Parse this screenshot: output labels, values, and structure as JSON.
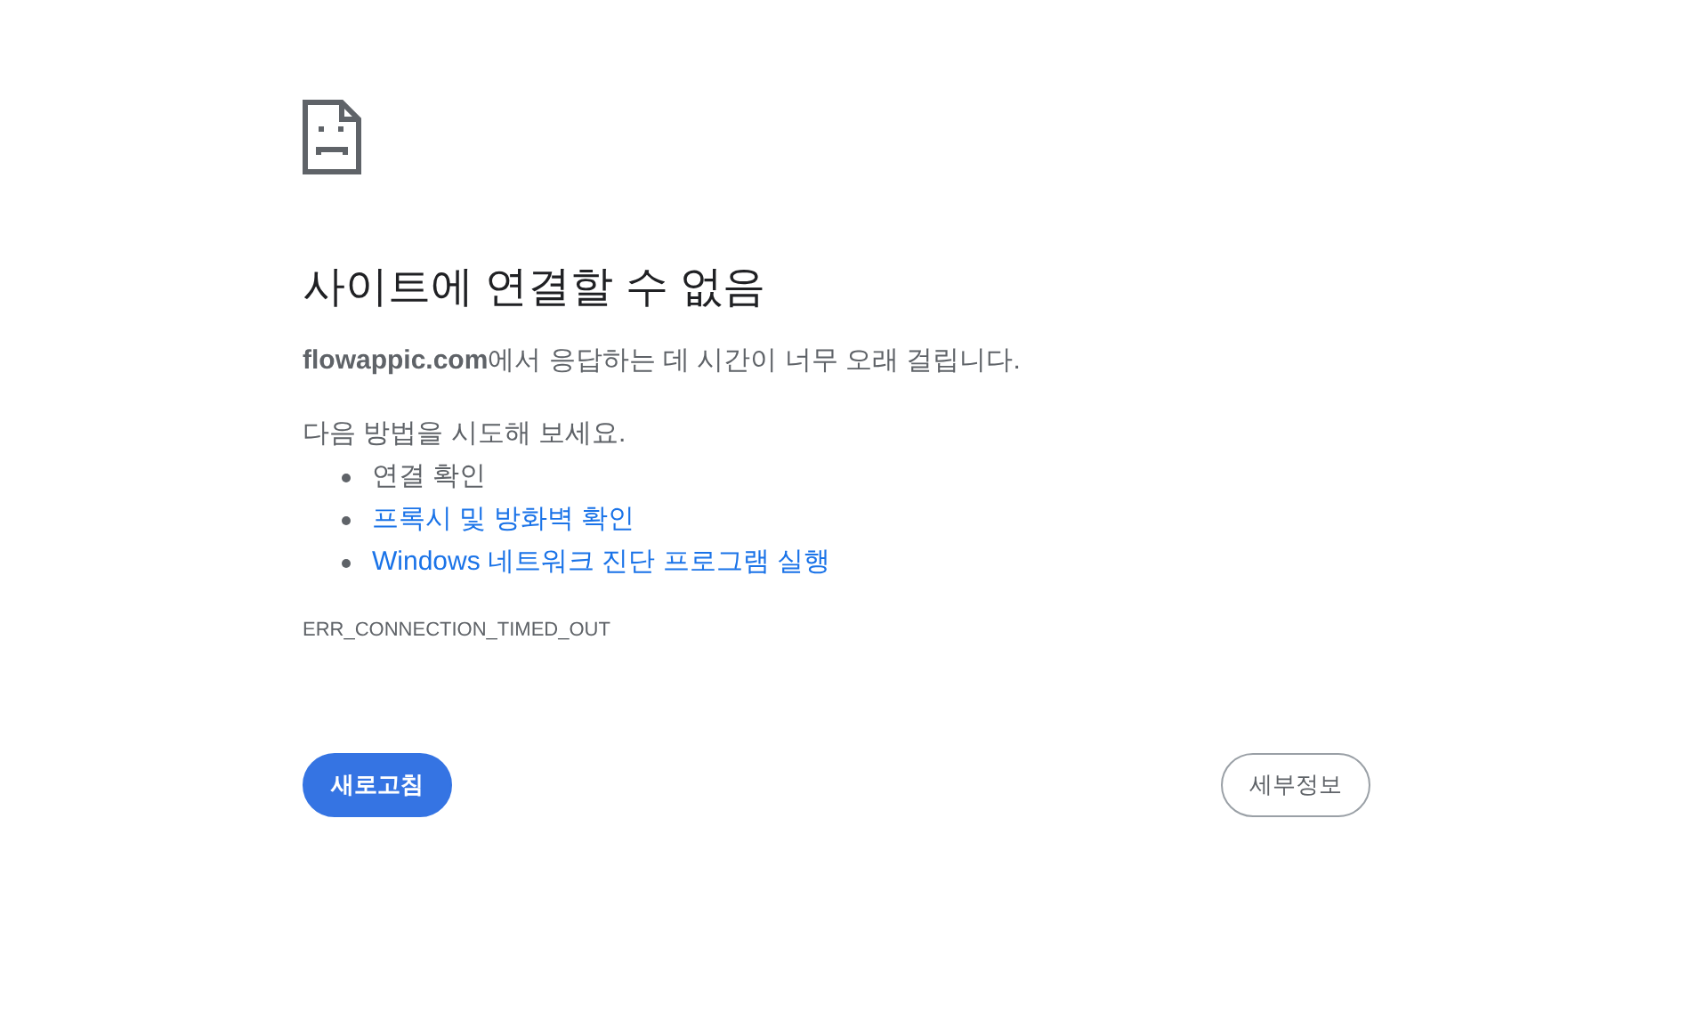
{
  "title": "사이트에 연결할 수 없음",
  "message": "**flowappic.com**에서 응답하는 데 시간이 너무 오래 걸립니다.",
  "suggestions_heading": "다음 방법을 시도해 보세요.",
  "suggestions": [
    {
      "kind": "text",
      "label": "연결 확인"
    },
    {
      "kind": "link",
      "label": "프록시 및 방화벽 확인"
    },
    {
      "kind": "link",
      "label": "Windows 네트워크 진단 프로그램 실행"
    }
  ],
  "error_code": "ERR_CONNECTION_TIMED_OUT",
  "buttons": [
    {
      "kind": "primary",
      "label": "새로고침"
    },
    {
      "kind": "secondary",
      "label": "세부정보"
    }
  ]
}
